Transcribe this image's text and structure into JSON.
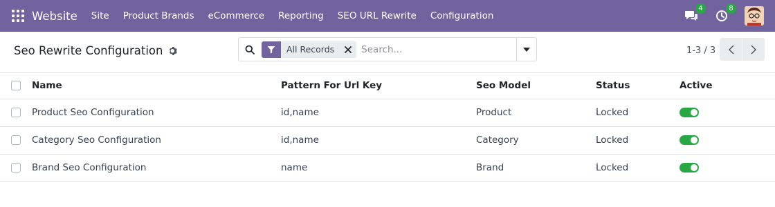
{
  "navbar": {
    "brand": "Website",
    "items": [
      "Site",
      "Product Brands",
      "eCommerce",
      "Reporting",
      "SEO URL Rewrite",
      "Configuration"
    ],
    "messages_count": "4",
    "activities_count": "8"
  },
  "control_panel": {
    "title": "Seo Rewrite Configuration",
    "facet_label": "All Records",
    "search_placeholder": "Search...",
    "pager_value": "1-3 / 3"
  },
  "table": {
    "headers": {
      "name": "Name",
      "pattern": "Pattern For Url Key",
      "model": "Seo Model",
      "status": "Status",
      "active": "Active"
    },
    "rows": [
      {
        "name": "Product Seo Configuration",
        "pattern": "id,name",
        "model": "Product",
        "status": "Locked",
        "active": true
      },
      {
        "name": "Category Seo Configuration",
        "pattern": "id,name",
        "model": "Category",
        "status": "Locked",
        "active": true
      },
      {
        "name": "Brand Seo Configuration",
        "pattern": "name",
        "model": "Brand",
        "status": "Locked",
        "active": true
      }
    ]
  },
  "colors": {
    "navbar": "#71639e",
    "toggle_on": "#28a745",
    "badge": "#28a745"
  },
  "icons": {
    "apps": "apps-grid-icon",
    "messages": "chat-bubbles-icon",
    "activities": "clock-icon",
    "settings": "gear-icon",
    "search": "search-icon",
    "filter": "filter-icon",
    "remove": "close-icon",
    "toggle": "caret-down-icon",
    "prev": "chevron-left-icon",
    "next": "chevron-right-icon"
  }
}
